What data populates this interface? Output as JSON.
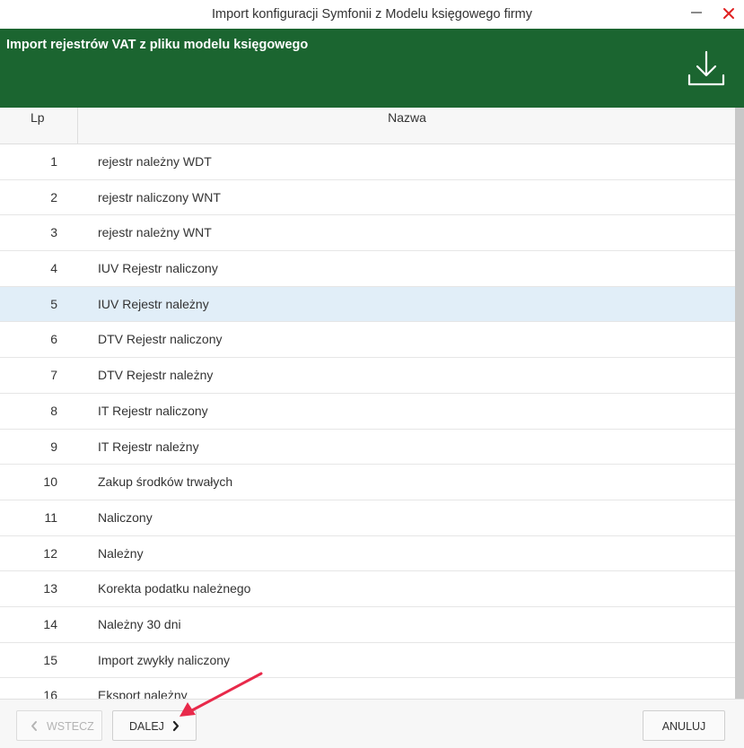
{
  "window": {
    "title": "Import konfiguracji Symfonii z Modelu księgowego firmy",
    "minimize_icon": "minimize-icon",
    "close_icon": "close-icon"
  },
  "banner": {
    "heading": "Import rejestrów VAT z pliku modelu księgowego",
    "icon": "download-icon",
    "color": "#1b6530"
  },
  "grid": {
    "columns": [
      "Lp",
      "Nazwa"
    ],
    "selected_index": 4,
    "rows": [
      {
        "lp": "1",
        "name": "rejestr należny WDT"
      },
      {
        "lp": "2",
        "name": "rejestr naliczony WNT"
      },
      {
        "lp": "3",
        "name": "rejestr należny WNT"
      },
      {
        "lp": "4",
        "name": "IUV Rejestr naliczony"
      },
      {
        "lp": "5",
        "name": "IUV Rejestr należny"
      },
      {
        "lp": "6",
        "name": "DTV Rejestr naliczony"
      },
      {
        "lp": "7",
        "name": "DTV Rejestr należny"
      },
      {
        "lp": "8",
        "name": "IT Rejestr naliczony"
      },
      {
        "lp": "9",
        "name": "IT Rejestr należny"
      },
      {
        "lp": "10",
        "name": "Zakup środków trwałych"
      },
      {
        "lp": "11",
        "name": "Naliczony"
      },
      {
        "lp": "12",
        "name": "Należny"
      },
      {
        "lp": "13",
        "name": "Korekta podatku należnego"
      },
      {
        "lp": "14",
        "name": "Należny 30 dni"
      },
      {
        "lp": "15",
        "name": "Import zwykły naliczony"
      },
      {
        "lp": "16",
        "name": "Eksport należny"
      }
    ]
  },
  "footer": {
    "back_label": "WSTECZ",
    "next_label": "DALEJ",
    "cancel_label": "ANULUJ"
  },
  "colors": {
    "selection": "#e1eef8",
    "close": "#e02020",
    "annotation_arrow": "#e8294a"
  }
}
